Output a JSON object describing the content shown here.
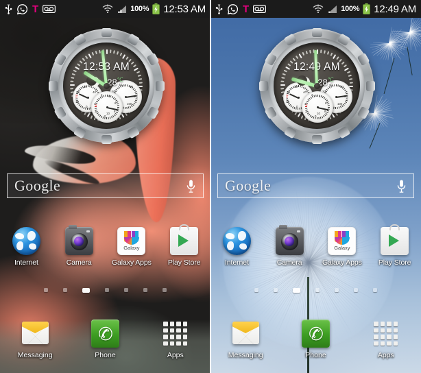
{
  "screens": [
    {
      "id": "left",
      "wallpaper": "flamingo-photo",
      "statusbar": {
        "left_icons": [
          "usb-icon",
          "whatsapp-icon",
          "tmobile-logo-icon",
          "voicemail-icon"
        ],
        "wifi_icon": "wifi-icon",
        "signal_icon": "cellular-signal-icon",
        "battery_percent": "100%",
        "battery_icon": "battery-charging-icon",
        "clock": "12:53 AM"
      },
      "watch_widget": {
        "time": "12:53 AM",
        "weather_icon": "moon-icon",
        "temperature": "28",
        "temperature_unit": "℃",
        "subdials": [
          {
            "name": "left-subdial",
            "labels": [
              "20",
              "30",
              "40",
              "10",
              "50",
              "0"
            ]
          },
          {
            "name": "right-subdial",
            "labels": [
              "20",
              "40",
              "60",
              "80",
              "0",
              "100"
            ]
          },
          {
            "name": "bottom-subdial",
            "labels": [
              "2",
              "4",
              "6",
              "8",
              "10",
              "0"
            ]
          }
        ]
      },
      "search": {
        "logo": "Google",
        "placeholder": "Google",
        "mic_icon": "microphone-icon"
      },
      "apps": [
        {
          "label": "Internet",
          "icon": "internet-globe-icon"
        },
        {
          "label": "Camera",
          "icon": "camera-icon"
        },
        {
          "label": "Galaxy Apps",
          "icon": "galaxy-apps-icon",
          "badge_text": "Galaxy"
        },
        {
          "label": "Play Store",
          "icon": "play-store-icon"
        }
      ],
      "page_dots": {
        "count": 7,
        "active_index": 2
      },
      "dock": [
        {
          "label": "Messaging",
          "icon": "messaging-envelope-icon"
        },
        {
          "label": "Phone",
          "icon": "phone-handset-icon",
          "glyph": "✆"
        },
        {
          "label": "Apps",
          "icon": "apps-grid-icon"
        }
      ]
    },
    {
      "id": "right",
      "wallpaper": "dandelion-photo",
      "statusbar": {
        "left_icons": [
          "usb-icon",
          "whatsapp-icon",
          "tmobile-logo-icon",
          "voicemail-icon"
        ],
        "wifi_icon": "wifi-icon",
        "signal_icon": "cellular-signal-icon",
        "battery_percent": "100%",
        "battery_icon": "battery-charging-icon",
        "clock": "12:49 AM"
      },
      "watch_widget": {
        "time": "12:49 AM",
        "weather_icon": "moon-icon",
        "temperature": "28",
        "temperature_unit": "℃",
        "subdials": [
          {
            "name": "left-subdial",
            "labels": [
              "20",
              "30",
              "40",
              "10",
              "50",
              "0"
            ]
          },
          {
            "name": "right-subdial",
            "labels": [
              "20",
              "40",
              "60",
              "80",
              "0",
              "100"
            ]
          },
          {
            "name": "bottom-subdial",
            "labels": [
              "2",
              "4",
              "6",
              "8",
              "10",
              "0"
            ]
          }
        ]
      },
      "search": {
        "logo": "Google",
        "placeholder": "Google",
        "mic_icon": "microphone-icon"
      },
      "apps": [
        {
          "label": "Internet",
          "icon": "internet-globe-icon"
        },
        {
          "label": "Camera",
          "icon": "camera-icon"
        },
        {
          "label": "Galaxy Apps",
          "icon": "galaxy-apps-icon",
          "badge_text": "Galaxy"
        },
        {
          "label": "Play Store",
          "icon": "play-store-icon"
        }
      ],
      "page_dots": {
        "count": 7,
        "active_index": 2
      },
      "dock": [
        {
          "label": "Messaging",
          "icon": "messaging-envelope-icon"
        },
        {
          "label": "Phone",
          "icon": "phone-handset-icon",
          "glyph": "✆"
        },
        {
          "label": "Apps",
          "icon": "apps-grid-icon"
        }
      ]
    }
  ],
  "colors": {
    "statusbar_bg": "#1b1b1b",
    "tmobile_magenta": "#e6007e",
    "battery_green": "#8bc34a",
    "phone_green": "#3d9e22",
    "envelope_yellow": "#f0b81d",
    "watch_hand_green": "#a8eda2"
  }
}
